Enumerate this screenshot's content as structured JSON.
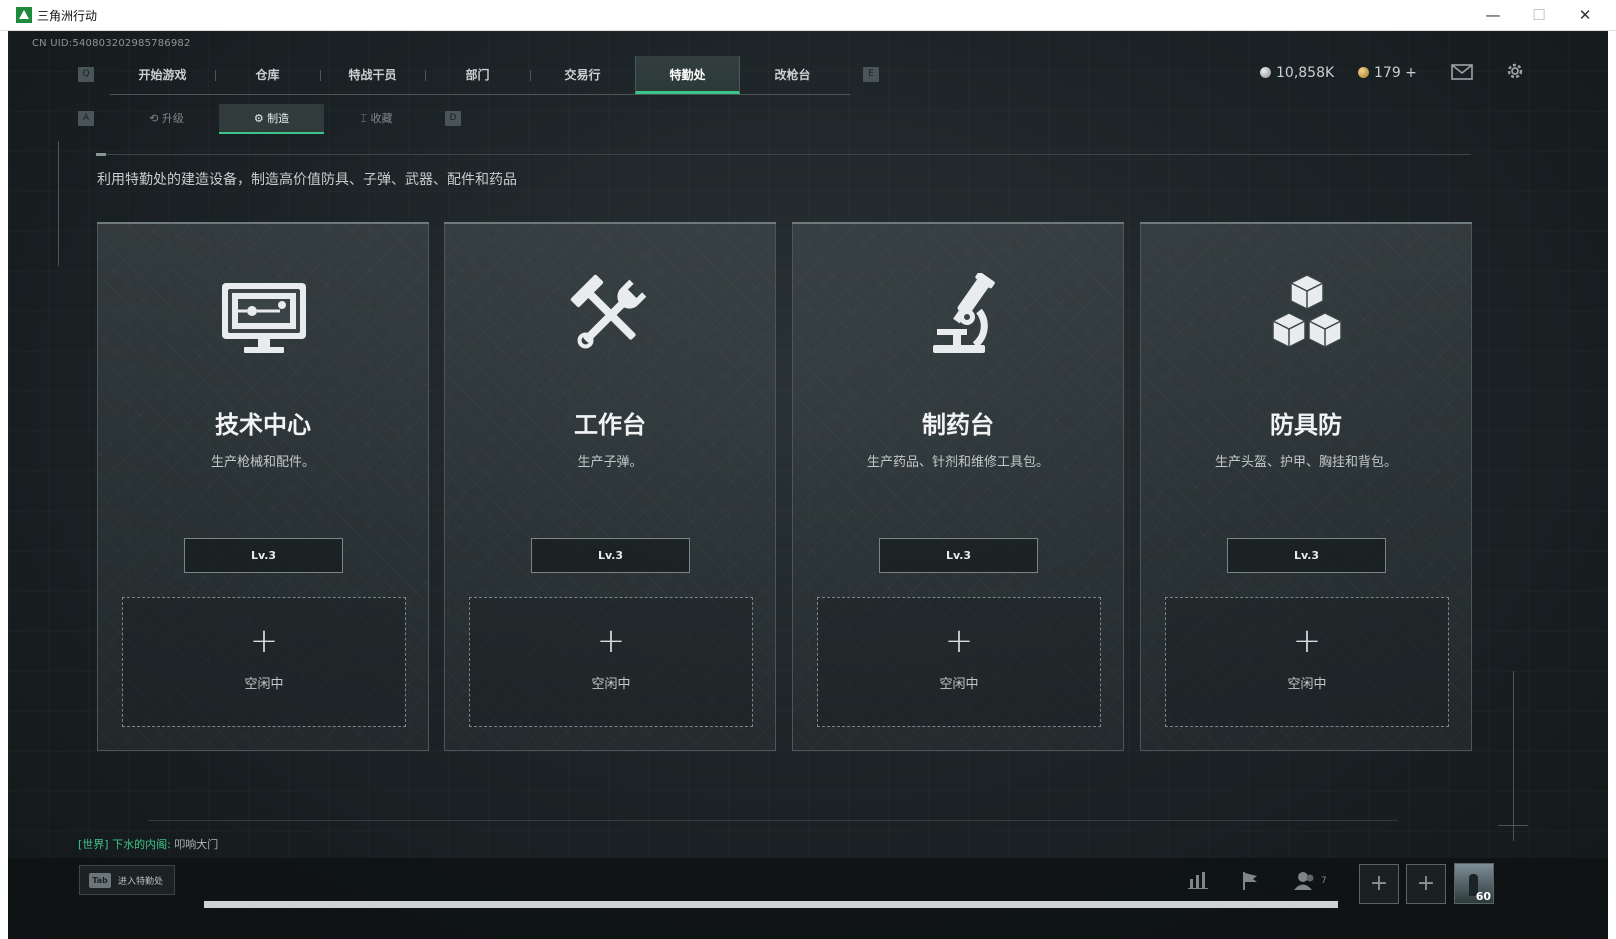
{
  "window": {
    "title": "三角洲行动",
    "minimize": "—",
    "maximize": "☐",
    "close": "✕"
  },
  "uid": "CN UID:540803202985786982",
  "nav": {
    "left_key": "Q",
    "right_key": "E",
    "tabs": [
      {
        "label": "开始游戏"
      },
      {
        "label": "仓库"
      },
      {
        "label": "特战干员"
      },
      {
        "label": "部门"
      },
      {
        "label": "交易行"
      },
      {
        "label": "特勤处",
        "active": true
      },
      {
        "label": "改枪台"
      }
    ]
  },
  "currency": {
    "silver": "10,858K",
    "gold": "179 +"
  },
  "icons": {
    "mail": "mail-icon",
    "settings": "gear-icon"
  },
  "subtabs": {
    "left_key": "A",
    "right_key": "D",
    "tabs": [
      {
        "label": "升级",
        "icon": "upgrade-icon"
      },
      {
        "label": "制造",
        "icon": "gear-icon",
        "active": true
      },
      {
        "label": "收藏",
        "icon": "collect-icon"
      }
    ]
  },
  "description": "利用特勤处的建造设备，制造高价值防具、子弹、武器、配件和药品",
  "stations": [
    {
      "name": "技术中心",
      "desc": "生产枪械和配件。",
      "level": "Lv.3",
      "slot_plus": "+",
      "slot_status": "空闲中",
      "icon": "monitor-icon"
    },
    {
      "name": "工作台",
      "desc": "生产子弹。",
      "level": "Lv.3",
      "slot_plus": "+",
      "slot_status": "空闲中",
      "icon": "tools-icon"
    },
    {
      "name": "制药台",
      "desc": "生产药品、针剂和维修工具包。",
      "level": "Lv.3",
      "slot_plus": "+",
      "slot_status": "空闲中",
      "icon": "microscope-icon"
    },
    {
      "name": "防具防",
      "desc": "生产头盔、护甲、胸挂和背包。",
      "level": "Lv.3",
      "slot_plus": "+",
      "slot_status": "空闲中",
      "icon": "cubes-icon"
    }
  ],
  "chat": {
    "channel": "[世界]",
    "user": "下水的内阁:",
    "message": "叩响大门"
  },
  "bottom": {
    "tab_key": "Tab",
    "enter_label": "进入特勤处",
    "friend_count": "7",
    "avatar_level": "60",
    "slot_plus": "+"
  }
}
